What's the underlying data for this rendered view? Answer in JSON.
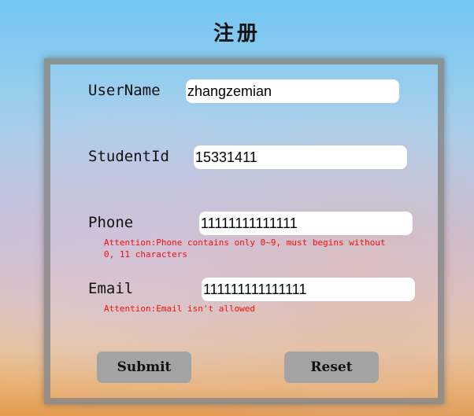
{
  "page": {
    "title": "注册"
  },
  "form": {
    "username": {
      "label": "UserName",
      "value": "zhangzemian"
    },
    "studentid": {
      "label": "StudentId",
      "value": "15331411"
    },
    "phone": {
      "label": "Phone",
      "value": "11111111111111",
      "warning": "Attention:Phone contains only 0~9, must begins without\n0, 11 characters"
    },
    "email": {
      "label": "Email",
      "value": "111111111111111",
      "warning": "Attention:Email isn't allowed"
    },
    "buttons": {
      "submit": "Submit",
      "reset": "Reset"
    }
  }
}
